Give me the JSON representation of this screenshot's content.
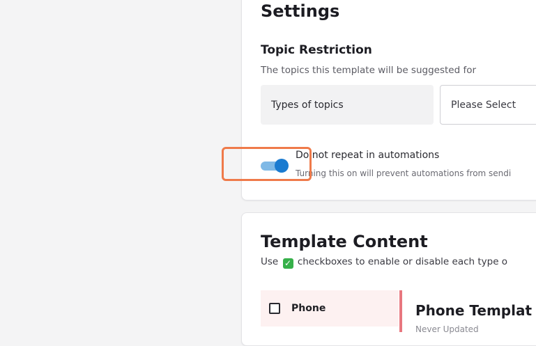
{
  "settings": {
    "title": "Settings",
    "topic_restriction": {
      "title": "Topic Restriction",
      "description": "The topics this template will be suggested for",
      "types_label": "Types of topics",
      "select_placeholder": "Please Select"
    },
    "no_repeat": {
      "label": "Do not repeat in automations",
      "description": "Turning this on will prevent automations from sendi",
      "enabled": true
    }
  },
  "template_content": {
    "title": "Template Content",
    "description_prefix": "Use",
    "description_suffix": "checkboxes to enable or disable each type o",
    "phone_tab_label": "Phone",
    "phone_panel_title": "Phone Templat",
    "phone_panel_subtitle": "Never Updated"
  },
  "colors": {
    "toggle_on": "#1a7bd0",
    "highlight": "#ef7a4a",
    "accent_divider": "#e8777f"
  }
}
